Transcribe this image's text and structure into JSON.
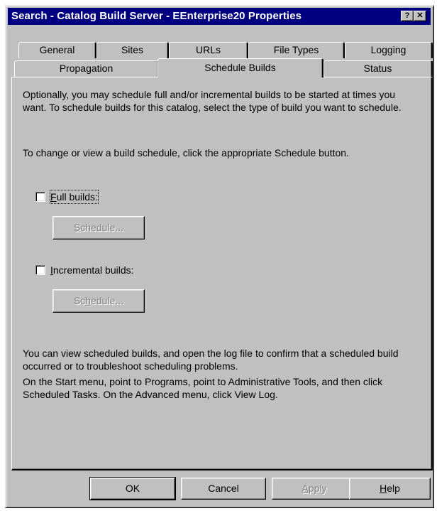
{
  "window": {
    "title": "Search - Catalog Build Server - EEnterprise20 Properties",
    "help_label": "?",
    "close_label": "✕"
  },
  "tabs": {
    "row1": [
      {
        "label": "General"
      },
      {
        "label": "Sites"
      },
      {
        "label": "URLs"
      },
      {
        "label": "File Types"
      },
      {
        "label": "Logging"
      }
    ],
    "row2": [
      {
        "label": "Propagation"
      },
      {
        "label": "Schedule Builds",
        "selected": true
      },
      {
        "label": "Status"
      }
    ]
  },
  "content": {
    "intro": "Optionally, you may schedule full and/or incremental builds to be started at times you want.  To schedule builds for this catalog, select the type of build you want to schedule.",
    "change_hint": "To change or view a build schedule, click the appropriate Schedule button.",
    "full_builds": {
      "label_first": "F",
      "label_rest": "ull builds:",
      "checked": false,
      "schedule_first": "S",
      "schedule_rest": "chedule..."
    },
    "incremental_builds": {
      "label_first": "I",
      "label_rest": "ncremental builds:",
      "checked": false,
      "schedule_first": "S",
      "schedule_rest": "chedule...",
      "schedule_pre": "",
      "schedule_pre2": "Sc",
      "schedule_mid": "h",
      "schedule_post": "edule..."
    },
    "footer1": "You can view scheduled builds, and open the log file to confirm that a scheduled build occurred or to troubleshoot scheduling problems.",
    "footer2": "On the Start menu, point to Programs, point to Administrative Tools, and then click Scheduled Tasks.  On the Advanced menu, click View Log."
  },
  "buttons": {
    "ok": "OK",
    "cancel": "Cancel",
    "apply_first": "A",
    "apply_rest": "pply",
    "help_first": "H",
    "help_rest": "elp"
  },
  "colors": {
    "titlebar": "#000080",
    "face": "#c0c0c0"
  }
}
